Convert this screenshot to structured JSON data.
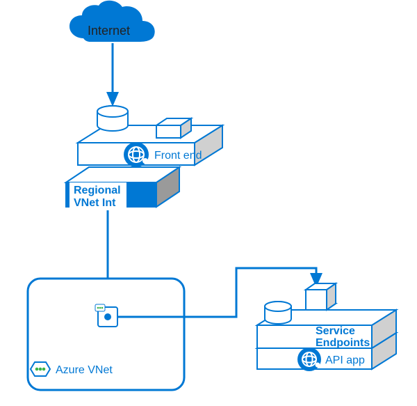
{
  "colors": {
    "azure_blue": "#0078d4",
    "azure_blue_dark": "#005a9e",
    "panel_fill": "#ffffff",
    "connector": "#0078d4"
  },
  "nodes": {
    "internet": {
      "label": "Internet",
      "icon": "cloud-icon"
    },
    "front_end": {
      "label": "Front end",
      "icon": "globe-app-icon"
    },
    "vnet_int": {
      "label_line1": "Regional",
      "label_line2": "VNet Int"
    },
    "azure_vnet": {
      "label": "Azure VNet",
      "icon": "vnet-icon"
    },
    "api_app": {
      "label": "API app",
      "icon": "globe-app-icon"
    },
    "service_ep": {
      "label_line1": "Service",
      "label_line2": "Endpoints"
    }
  },
  "edges": [
    {
      "from": "internet",
      "to": "front_end",
      "style": "arrow"
    },
    {
      "from": "vnet_int",
      "to": "azure_vnet",
      "style": "arrow"
    },
    {
      "from": "azure_vnet",
      "to": "api_app",
      "style": "elbow-arrow"
    }
  ]
}
